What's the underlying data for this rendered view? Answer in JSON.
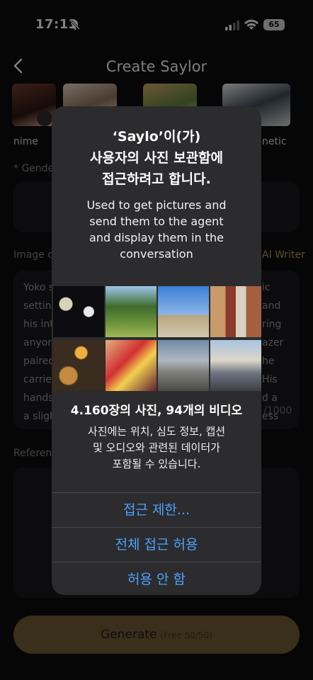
{
  "status": {
    "time": "17:13",
    "battery": "65"
  },
  "nav": {
    "title": "Create Saylor"
  },
  "styles": {
    "first_label": "nime",
    "last_label": "netic"
  },
  "form": {
    "gender_label": "* Gende",
    "image_label": "Image c",
    "ai_writer": "AI Writer",
    "description_left": [
      "Yoko s",
      "settin",
      "his int",
      "anyon",
      "paired",
      "carrie",
      "hands",
      "a slight"
    ],
    "description_right": [
      "ic",
      "and",
      "ring",
      "azer",
      "he",
      "His",
      "d a",
      "ess"
    ],
    "counter": "/1000",
    "reference_label": "Referen"
  },
  "generate": {
    "label": "Generate",
    "sub": "(Free 50/50)"
  },
  "alert": {
    "title_lines": [
      "‘Saylo’이(가)",
      "사용자의 사진 보관함에",
      "접근하려고 합니다."
    ],
    "message_lines": [
      "Used to get pictures and",
      "send them to the agent",
      "and display them in the",
      "conversation"
    ],
    "count": "4.160장의 사진, 94개의 비디오",
    "detail_lines": [
      "사진에는 위치, 심도 정보, 캡션",
      "및 오디오와 관련된 데이터가",
      "포함될 수 있습니다."
    ],
    "limit_button": "접근 제한...",
    "allow_all_button": "전체 접근 허용",
    "deny_button": "허용 안 함"
  },
  "colors": {
    "accent_blue": "#4ca2ff",
    "gold": "#a88a52",
    "alert_bg": "#2c2c2e"
  }
}
